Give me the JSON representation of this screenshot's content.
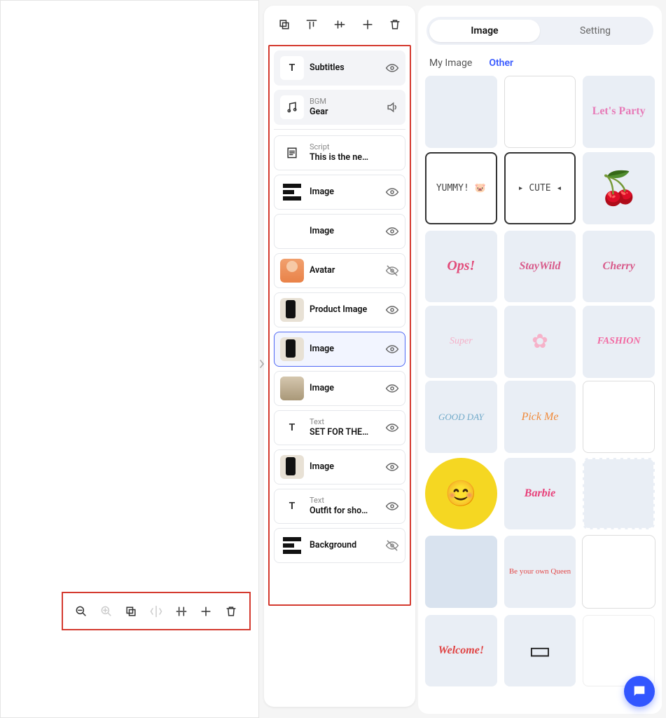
{
  "canvasToolbar": [
    {
      "name": "zoom-out-icon",
      "disabled": false
    },
    {
      "name": "zoom-in-icon",
      "disabled": true
    },
    {
      "name": "copy-icon",
      "disabled": false
    },
    {
      "name": "flip-horizontal-icon",
      "disabled": true
    },
    {
      "name": "align-horizontal-icon",
      "disabled": false
    },
    {
      "name": "plus-icon",
      "disabled": false
    },
    {
      "name": "trash-icon",
      "disabled": false
    }
  ],
  "layersToolbar": [
    {
      "name": "copy-icon"
    },
    {
      "name": "align-top-icon"
    },
    {
      "name": "align-center-icon"
    },
    {
      "name": "plus-icon"
    },
    {
      "name": "trash-icon"
    }
  ],
  "layers": [
    {
      "type": "text",
      "sub": "",
      "label": "Subtitles",
      "thumb": "T",
      "vis": "visible",
      "filled": true,
      "selected": false
    },
    {
      "type": "audio",
      "sub": "BGM",
      "label": "Gear",
      "thumb": "audio",
      "vis": "sound",
      "filled": true,
      "selected": false
    },
    {
      "type": "divider"
    },
    {
      "type": "script",
      "sub": "Script",
      "label": "This is the ne…",
      "thumb": "script",
      "vis": "none",
      "filled": false,
      "selected": false
    },
    {
      "type": "image",
      "sub": "",
      "label": "Image",
      "thumb": "bars",
      "vis": "visible",
      "filled": false,
      "selected": false
    },
    {
      "type": "image",
      "sub": "",
      "label": "Image",
      "thumb": "blank",
      "vis": "visible",
      "filled": false,
      "selected": false
    },
    {
      "type": "avatar",
      "sub": "",
      "label": "Avatar",
      "thumb": "avatar",
      "vis": "hidden",
      "filled": false,
      "selected": false
    },
    {
      "type": "image",
      "sub": "",
      "label": "Product Image",
      "thumb": "photo2",
      "vis": "visible",
      "filled": false,
      "selected": false
    },
    {
      "type": "image",
      "sub": "",
      "label": "Image",
      "thumb": "photo2",
      "vis": "visible",
      "filled": false,
      "selected": true
    },
    {
      "type": "image",
      "sub": "",
      "label": "Image",
      "thumb": "photo",
      "vis": "visible",
      "filled": false,
      "selected": false
    },
    {
      "type": "text",
      "sub": "Text",
      "label": "SET FOR THE…",
      "thumb": "T",
      "vis": "visible",
      "filled": false,
      "selected": false
    },
    {
      "type": "image",
      "sub": "",
      "label": "Image",
      "thumb": "photo2",
      "vis": "visible",
      "filled": false,
      "selected": false
    },
    {
      "type": "text",
      "sub": "Text",
      "label": "Outfit for sho…",
      "thumb": "T",
      "vis": "visible",
      "filled": false,
      "selected": false
    },
    {
      "type": "image",
      "sub": "",
      "label": "Background",
      "thumb": "bars",
      "vis": "hidden",
      "filled": false,
      "selected": false
    }
  ],
  "segments": {
    "image": "Image",
    "setting": "Setting",
    "active": "image"
  },
  "tabs": {
    "my": "My Image",
    "other": "Other",
    "active": "other"
  },
  "assets": [
    {
      "label": "",
      "style": "color:#c8b4e8"
    },
    {
      "label": "",
      "style": "background:#fff;border:1px solid #ddd"
    },
    {
      "label": "Let's Party",
      "style": "color:#e77bb8;font-weight:700"
    },
    {
      "label": "YUMMY! 🐷",
      "style": "background:#fff;color:#444;font-family:monospace;font-size:13px;border:2px solid #333"
    },
    {
      "label": "▸ CUTE ◂",
      "style": "background:#fff;color:#444;font-family:monospace;font-size:13px;border:2px solid #333"
    },
    {
      "label": "🍒",
      "style": "font-size:46px;font-family:sans-serif"
    },
    {
      "label": "Ops!",
      "style": "color:#e24d7b;font-weight:800;font-style:italic;font-size:20px"
    },
    {
      "label": "StayWild",
      "style": "color:#d85a8a;font-weight:800;font-style:italic"
    },
    {
      "label": "Cherry",
      "style": "color:#d85a8a;font-weight:800;font-style:italic"
    },
    {
      "label": "Super",
      "style": "color:#f5b0c8;font-style:italic;font-size:14px"
    },
    {
      "label": "✿",
      "style": "color:#f6b2c9;font-size:28px"
    },
    {
      "label": "FASHION",
      "style": "color:#f26aa2;font-weight:800;font-style:italic;font-size:14px"
    },
    {
      "label": "GOOD DAY",
      "style": "color:#6fa9c9;font-style:italic;font-size:13px"
    },
    {
      "label": "Pick Me",
      "style": "color:#f08a3a;font-style:italic"
    },
    {
      "label": "",
      "style": "background:#fff;border:1px solid #ddd"
    },
    {
      "label": "😊",
      "style": "background:#f5d722;border-radius:50%;font-size:36px;font-family:sans-serif"
    },
    {
      "label": "Barbie",
      "style": "color:#e8417a;font-weight:800;font-style:italic"
    },
    {
      "label": "",
      "style": "border:2px dashed #fff"
    },
    {
      "label": "",
      "style": "background:#d9e3ef"
    },
    {
      "label": "Be your own Queen",
      "style": "color:#e34949;font-size:11px"
    },
    {
      "label": "",
      "style": "background:#fff;border:6px solid #fff;box-shadow:0 0 0 1px #ddd"
    },
    {
      "label": "Welcome!",
      "style": "color:#e04242;font-weight:800;font-style:italic"
    },
    {
      "label": "▭",
      "style": "color:#222;font-size:34px;font-family:sans-serif"
    },
    {
      "label": "",
      "style": "background:#fff;border:1px solid #eee"
    }
  ]
}
